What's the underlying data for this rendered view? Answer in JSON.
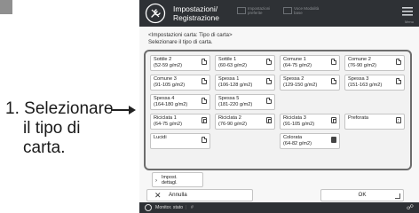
{
  "callout": {
    "number": "1.",
    "line1": "Selezionare",
    "line2": "il tipo di",
    "line3": "carta."
  },
  "topbar": {
    "title_line1": "Impostazioni/",
    "title_line2": "Registrazione",
    "chip1_line1": "Impostazioni",
    "chip1_line2": "preferite",
    "chip2_line1": "Voce Modalità",
    "chip2_line2": "base",
    "menu_label": "Menu"
  },
  "breadcrumb": {
    "line1": "<Impostazioni carta: Tipo di carta>",
    "line2": "Selezionare il tipo di carta."
  },
  "paper_types": [
    {
      "line1": "Sottile 2",
      "line2": "(52-59 g/m2)",
      "icon": "sheet-icon"
    },
    {
      "line1": "Sottile 1",
      "line2": "(60-63 g/m2)",
      "icon": "sheet-icon"
    },
    {
      "line1": "Comune 1",
      "line2": "(64-75 g/m2)",
      "icon": "sheet-icon"
    },
    {
      "line1": "Comune 2",
      "line2": "(76-90 g/m2)",
      "icon": "sheet-icon"
    },
    {
      "line1": "Comune 3",
      "line2": "(91-105 g/m2)",
      "icon": "sheet-icon"
    },
    {
      "line1": "Spessa 1",
      "line2": "(106-128 g/m2)",
      "icon": "sheet-icon"
    },
    {
      "line1": "Spessa 2",
      "line2": "(129-150 g/m2)",
      "icon": "sheet-icon"
    },
    {
      "line1": "Spessa 3",
      "line2": "(151-163 g/m2)",
      "icon": "sheet-icon"
    },
    {
      "line1": "Spessa 4",
      "line2": "(164-180 g/m2)",
      "icon": "sheet-icon"
    },
    {
      "line1": "Spessa 5",
      "line2": "(181-220 g/m2)",
      "icon": "sheet-icon"
    },
    {
      "line1": "Riciclata 1",
      "line2": "(64-75 g/m2)",
      "icon": "recycled-icon"
    },
    {
      "line1": "Riciclata 2",
      "line2": "(76-90 g/m2)",
      "icon": "recycled-icon"
    },
    {
      "line1": "Riciclata 3",
      "line2": "(91-105 g/m2)",
      "icon": "recycled-icon"
    },
    {
      "line1": "Preforata",
      "line2": "",
      "icon": "punched-icon"
    },
    {
      "line1": "Lucidi",
      "line2": "",
      "icon": "sheet-icon"
    },
    {
      "line1": "Colorata",
      "line2": "(64-82 g/m2)",
      "icon": "colored-icon"
    }
  ],
  "impost_button": {
    "line1": "Impost.",
    "line2": "dettagl."
  },
  "buttons": {
    "cancel": "Annulla",
    "ok": "OK"
  },
  "statusbar": {
    "monitor": "Monitor. stato",
    "hash": "#"
  },
  "colors": {
    "topbar_bg": "#2e3135",
    "panel_border": "#6d6d6d"
  }
}
